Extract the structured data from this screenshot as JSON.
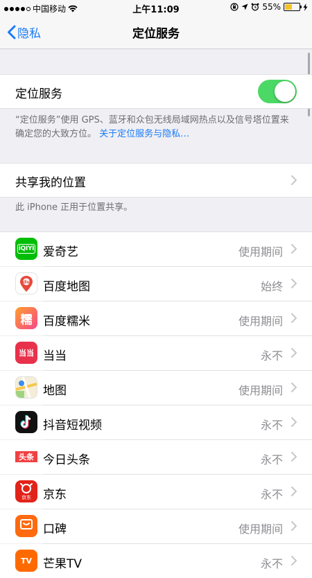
{
  "status_bar": {
    "carrier": "中国移动",
    "time": "上午11:09",
    "battery_percent": "55%",
    "battery_level": 0.55,
    "battery_color": "#f6c325"
  },
  "nav": {
    "back_label": "隐私",
    "title": "定位服务"
  },
  "location_services": {
    "label": "定位服务",
    "enabled": true,
    "toggle_color": "#4cd864",
    "description": "“定位服务”使用 GPS、蓝牙和众包无线局域网热点以及信号塔位置来确定您的大致方位。",
    "link_text": "关于定位服务与隐私…"
  },
  "share_location": {
    "label": "共享我的位置",
    "footer": "此 iPhone 正用于位置共享。"
  },
  "apps": [
    {
      "name": "爱奇艺",
      "value": "使用期间",
      "icon": "iqiyi-icon"
    },
    {
      "name": "百度地图",
      "value": "始终",
      "icon": "baidu-map-icon"
    },
    {
      "name": "百度糯米",
      "value": "使用期间",
      "icon": "baidu-nuomi-icon"
    },
    {
      "name": "当当",
      "value": "永不",
      "icon": "dangdang-icon"
    },
    {
      "name": "地图",
      "value": "使用期间",
      "icon": "maps-icon"
    },
    {
      "name": "抖音短视频",
      "value": "永不",
      "icon": "douyin-icon"
    },
    {
      "name": "今日头条",
      "value": "永不",
      "icon": "toutiao-icon"
    },
    {
      "name": "京东",
      "value": "永不",
      "icon": "jd-icon"
    },
    {
      "name": "口碑",
      "value": "使用期间",
      "icon": "koubei-icon"
    },
    {
      "name": "芒果TV",
      "value": "永不",
      "icon": "mango-tv-icon"
    }
  ],
  "app_icon_glyphs": {
    "iqiyi": "iQIYI",
    "baidu_map": "du",
    "nuomi": "糯",
    "dangdang": "当当",
    "toutiao": "头条",
    "jd": "京东",
    "mango": "TV"
  },
  "colors": {
    "accent": "#1a7bf6",
    "background": "#efeff4"
  }
}
